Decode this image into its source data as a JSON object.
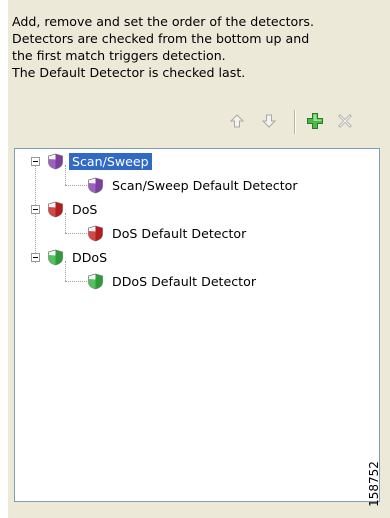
{
  "description": {
    "lines": [
      "Add, remove and set the order of the detectors.",
      "Detectors are checked from the bottom up and",
      "the first match triggers detection.",
      "The Default Detector is checked last."
    ]
  },
  "toolbar": {
    "icons": [
      "move-up-icon",
      "move-down-icon",
      "add-icon",
      "remove-icon"
    ]
  },
  "tree": {
    "groups": [
      {
        "label": "Scan/Sweep",
        "selected": true,
        "color": "#7B3F9E",
        "child": "Scan/Sweep Default Detector"
      },
      {
        "label": "DoS",
        "selected": false,
        "color": "#B02020",
        "child": "DoS Default Detector"
      },
      {
        "label": "DDoS",
        "selected": false,
        "color": "#2E9A3A",
        "child": "DDoS Default Detector"
      }
    ]
  },
  "figure_id": "158752"
}
